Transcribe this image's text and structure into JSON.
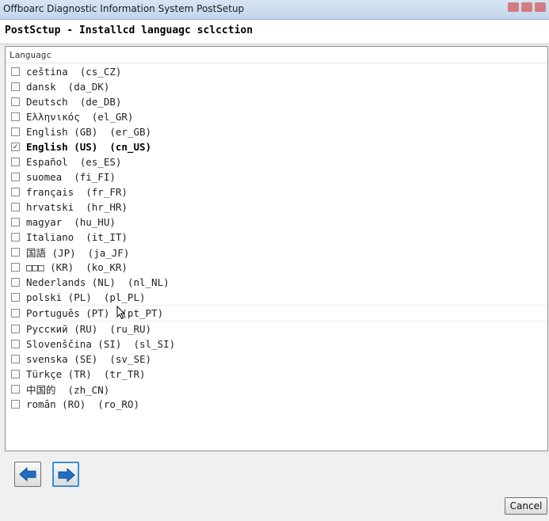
{
  "window": {
    "title": "Offboarc Diagnostic Information System PostSetup"
  },
  "header": {
    "title": "PostSctup - Installcd languagc sclcction"
  },
  "list": {
    "column_header": "Languagc",
    "items": [
      {
        "label": "ceština  (cs_CZ)",
        "checked": false
      },
      {
        "label": "dansk  (da_DK)",
        "checked": false
      },
      {
        "label": "Deutsch  (de_DB)",
        "checked": false
      },
      {
        "label": "Ελληνικός  (el_GR)",
        "checked": false
      },
      {
        "label": "English (GB)  (er_GB)",
        "checked": false
      },
      {
        "label": "English (US)  (cn_US)",
        "checked": true
      },
      {
        "label": "Español  (es_ES)",
        "checked": false
      },
      {
        "label": "suomea  (fi_FI)",
        "checked": false
      },
      {
        "label": "français  (fr_FR)",
        "checked": false
      },
      {
        "label": "hrvatski  (hr_HR)",
        "checked": false
      },
      {
        "label": "magyar  (hu_HU)",
        "checked": false
      },
      {
        "label": "Italiano  (it_IT)",
        "checked": false
      },
      {
        "label": "国語 (JP)  (ja_JF)",
        "checked": false
      },
      {
        "label": "□□□ (KR)  (ko_KR)",
        "checked": false
      },
      {
        "label": "Nederlands (NL)  (nl_NL)",
        "checked": false
      },
      {
        "label": "polski (PL)  (pl_PL)",
        "checked": false
      },
      {
        "label": "Português (PT)  (pt_PT)",
        "checked": false
      },
      {
        "label": "Русский (RU)  (ru_RU)",
        "checked": false
      },
      {
        "label": "Slovenščina (SI)  (sl_SI)",
        "checked": false
      },
      {
        "label": "svenska (SE)  (sv_SE)",
        "checked": false
      },
      {
        "label": "Türkçe (TR)  (tr_TR)",
        "checked": false
      },
      {
        "label": "中国的  (zh_CN)",
        "checked": false
      },
      {
        "label": "român (RO)  (ro_RO)",
        "checked": false
      }
    ]
  },
  "buttons": {
    "cancel": "Cancel"
  },
  "icons": {
    "back": "arrow-left-icon",
    "next": "arrow-right-icon",
    "check": "✓"
  },
  "colors": {
    "arrow": "#1f6fc4",
    "accent": "#3a8fd8"
  }
}
